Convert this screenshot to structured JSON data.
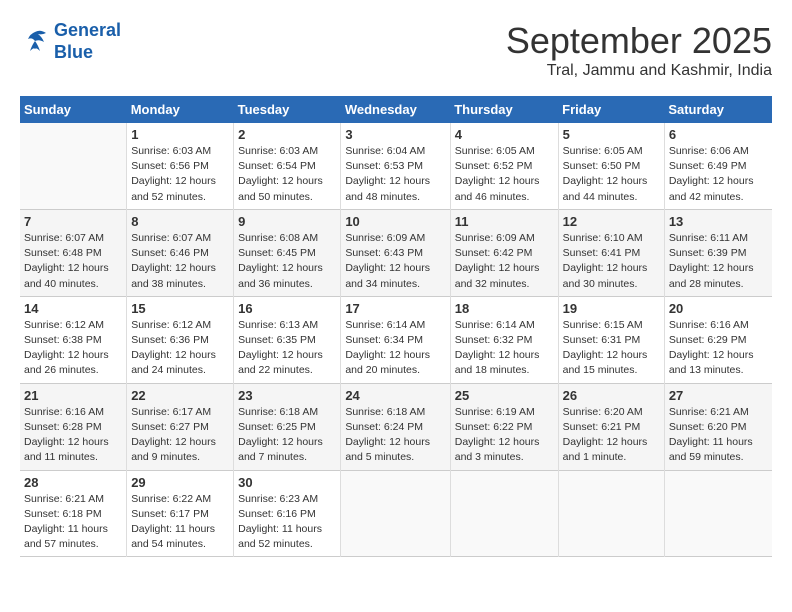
{
  "header": {
    "logo_line1": "General",
    "logo_line2": "Blue",
    "month_title": "September 2025",
    "subtitle": "Tral, Jammu and Kashmir, India"
  },
  "weekdays": [
    "Sunday",
    "Monday",
    "Tuesday",
    "Wednesday",
    "Thursday",
    "Friday",
    "Saturday"
  ],
  "weeks": [
    [
      {
        "day": "",
        "sunrise": "",
        "sunset": "",
        "daylight": ""
      },
      {
        "day": "1",
        "sunrise": "Sunrise: 6:03 AM",
        "sunset": "Sunset: 6:56 PM",
        "daylight": "Daylight: 12 hours and 52 minutes."
      },
      {
        "day": "2",
        "sunrise": "Sunrise: 6:03 AM",
        "sunset": "Sunset: 6:54 PM",
        "daylight": "Daylight: 12 hours and 50 minutes."
      },
      {
        "day": "3",
        "sunrise": "Sunrise: 6:04 AM",
        "sunset": "Sunset: 6:53 PM",
        "daylight": "Daylight: 12 hours and 48 minutes."
      },
      {
        "day": "4",
        "sunrise": "Sunrise: 6:05 AM",
        "sunset": "Sunset: 6:52 PM",
        "daylight": "Daylight: 12 hours and 46 minutes."
      },
      {
        "day": "5",
        "sunrise": "Sunrise: 6:05 AM",
        "sunset": "Sunset: 6:50 PM",
        "daylight": "Daylight: 12 hours and 44 minutes."
      },
      {
        "day": "6",
        "sunrise": "Sunrise: 6:06 AM",
        "sunset": "Sunset: 6:49 PM",
        "daylight": "Daylight: 12 hours and 42 minutes."
      }
    ],
    [
      {
        "day": "7",
        "sunrise": "Sunrise: 6:07 AM",
        "sunset": "Sunset: 6:48 PM",
        "daylight": "Daylight: 12 hours and 40 minutes."
      },
      {
        "day": "8",
        "sunrise": "Sunrise: 6:07 AM",
        "sunset": "Sunset: 6:46 PM",
        "daylight": "Daylight: 12 hours and 38 minutes."
      },
      {
        "day": "9",
        "sunrise": "Sunrise: 6:08 AM",
        "sunset": "Sunset: 6:45 PM",
        "daylight": "Daylight: 12 hours and 36 minutes."
      },
      {
        "day": "10",
        "sunrise": "Sunrise: 6:09 AM",
        "sunset": "Sunset: 6:43 PM",
        "daylight": "Daylight: 12 hours and 34 minutes."
      },
      {
        "day": "11",
        "sunrise": "Sunrise: 6:09 AM",
        "sunset": "Sunset: 6:42 PM",
        "daylight": "Daylight: 12 hours and 32 minutes."
      },
      {
        "day": "12",
        "sunrise": "Sunrise: 6:10 AM",
        "sunset": "Sunset: 6:41 PM",
        "daylight": "Daylight: 12 hours and 30 minutes."
      },
      {
        "day": "13",
        "sunrise": "Sunrise: 6:11 AM",
        "sunset": "Sunset: 6:39 PM",
        "daylight": "Daylight: 12 hours and 28 minutes."
      }
    ],
    [
      {
        "day": "14",
        "sunrise": "Sunrise: 6:12 AM",
        "sunset": "Sunset: 6:38 PM",
        "daylight": "Daylight: 12 hours and 26 minutes."
      },
      {
        "day": "15",
        "sunrise": "Sunrise: 6:12 AM",
        "sunset": "Sunset: 6:36 PM",
        "daylight": "Daylight: 12 hours and 24 minutes."
      },
      {
        "day": "16",
        "sunrise": "Sunrise: 6:13 AM",
        "sunset": "Sunset: 6:35 PM",
        "daylight": "Daylight: 12 hours and 22 minutes."
      },
      {
        "day": "17",
        "sunrise": "Sunrise: 6:14 AM",
        "sunset": "Sunset: 6:34 PM",
        "daylight": "Daylight: 12 hours and 20 minutes."
      },
      {
        "day": "18",
        "sunrise": "Sunrise: 6:14 AM",
        "sunset": "Sunset: 6:32 PM",
        "daylight": "Daylight: 12 hours and 18 minutes."
      },
      {
        "day": "19",
        "sunrise": "Sunrise: 6:15 AM",
        "sunset": "Sunset: 6:31 PM",
        "daylight": "Daylight: 12 hours and 15 minutes."
      },
      {
        "day": "20",
        "sunrise": "Sunrise: 6:16 AM",
        "sunset": "Sunset: 6:29 PM",
        "daylight": "Daylight: 12 hours and 13 minutes."
      }
    ],
    [
      {
        "day": "21",
        "sunrise": "Sunrise: 6:16 AM",
        "sunset": "Sunset: 6:28 PM",
        "daylight": "Daylight: 12 hours and 11 minutes."
      },
      {
        "day": "22",
        "sunrise": "Sunrise: 6:17 AM",
        "sunset": "Sunset: 6:27 PM",
        "daylight": "Daylight: 12 hours and 9 minutes."
      },
      {
        "day": "23",
        "sunrise": "Sunrise: 6:18 AM",
        "sunset": "Sunset: 6:25 PM",
        "daylight": "Daylight: 12 hours and 7 minutes."
      },
      {
        "day": "24",
        "sunrise": "Sunrise: 6:18 AM",
        "sunset": "Sunset: 6:24 PM",
        "daylight": "Daylight: 12 hours and 5 minutes."
      },
      {
        "day": "25",
        "sunrise": "Sunrise: 6:19 AM",
        "sunset": "Sunset: 6:22 PM",
        "daylight": "Daylight: 12 hours and 3 minutes."
      },
      {
        "day": "26",
        "sunrise": "Sunrise: 6:20 AM",
        "sunset": "Sunset: 6:21 PM",
        "daylight": "Daylight: 12 hours and 1 minute."
      },
      {
        "day": "27",
        "sunrise": "Sunrise: 6:21 AM",
        "sunset": "Sunset: 6:20 PM",
        "daylight": "Daylight: 11 hours and 59 minutes."
      }
    ],
    [
      {
        "day": "28",
        "sunrise": "Sunrise: 6:21 AM",
        "sunset": "Sunset: 6:18 PM",
        "daylight": "Daylight: 11 hours and 57 minutes."
      },
      {
        "day": "29",
        "sunrise": "Sunrise: 6:22 AM",
        "sunset": "Sunset: 6:17 PM",
        "daylight": "Daylight: 11 hours and 54 minutes."
      },
      {
        "day": "30",
        "sunrise": "Sunrise: 6:23 AM",
        "sunset": "Sunset: 6:16 PM",
        "daylight": "Daylight: 11 hours and 52 minutes."
      },
      {
        "day": "",
        "sunrise": "",
        "sunset": "",
        "daylight": ""
      },
      {
        "day": "",
        "sunrise": "",
        "sunset": "",
        "daylight": ""
      },
      {
        "day": "",
        "sunrise": "",
        "sunset": "",
        "daylight": ""
      },
      {
        "day": "",
        "sunrise": "",
        "sunset": "",
        "daylight": ""
      }
    ]
  ]
}
